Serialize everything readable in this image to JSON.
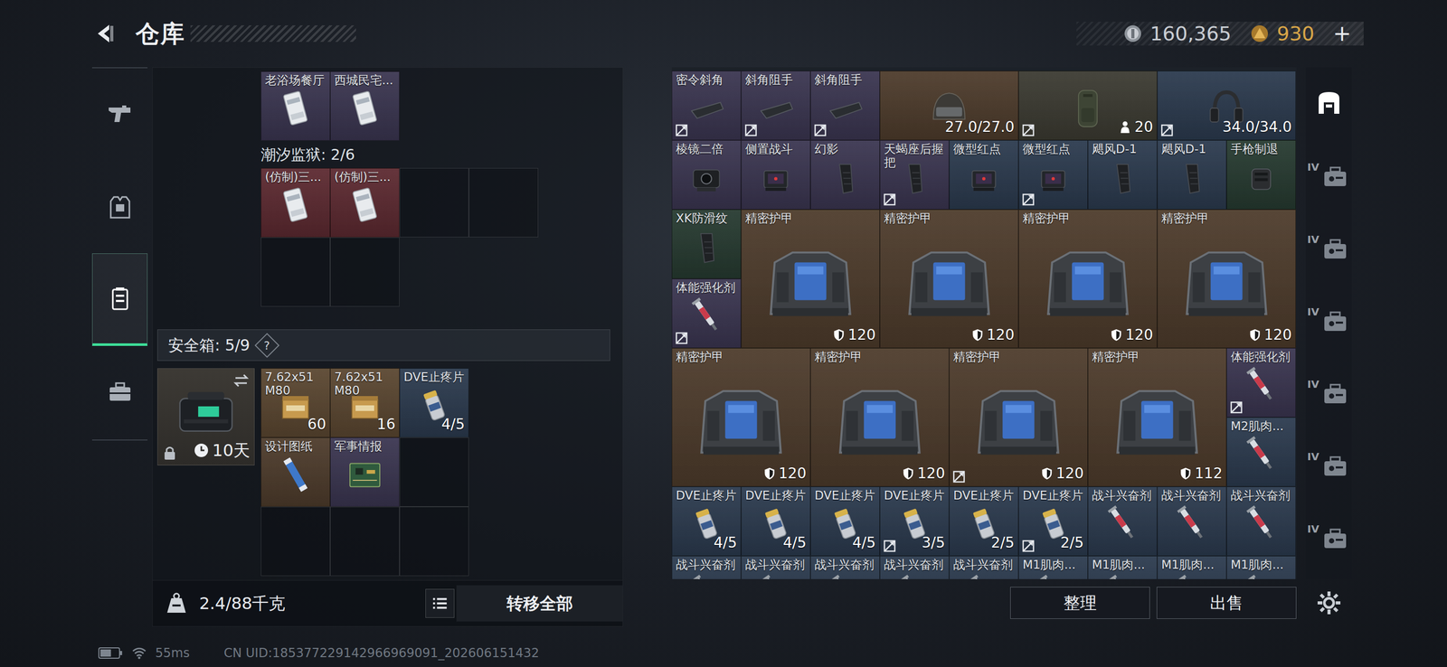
{
  "header": {
    "title": "仓库"
  },
  "wallet": {
    "currencies": [
      {
        "amount": "160,365",
        "color": "#c9cdd3"
      },
      {
        "amount": "930",
        "color": "#d8a548"
      }
    ],
    "topup": "+"
  },
  "sidebar": {
    "items": [
      {
        "kind": "weapon",
        "selected": false
      },
      {
        "kind": "gear",
        "selected": false
      },
      {
        "kind": "container",
        "selected": true
      },
      {
        "kind": "case",
        "selected": false
      }
    ]
  },
  "stash": {
    "sections": [
      {
        "slots": [
          {
            "kind": "key",
            "label": "老浴场餐厅",
            "color": "#3a3550"
          },
          {
            "kind": "key",
            "label": "西城民宅...",
            "color": "#3a3550"
          }
        ]
      },
      {
        "title": "潮汐监狱: 2/6",
        "slots": [
          {
            "kind": "key",
            "label": "(仿制)三...",
            "color": "#5c2930"
          },
          {
            "kind": "key",
            "label": "(仿制)三...",
            "color": "#5c2930"
          },
          {
            "kind": "empty"
          },
          {
            "kind": "empty"
          },
          {
            "kind": "empty"
          },
          {
            "kind": "empty"
          }
        ]
      }
    ],
    "safe_box": {
      "title": "安全箱: 5/9",
      "help": "?",
      "timer": "10天",
      "locked": true,
      "slots": [
        {
          "kind": "ammo",
          "label": "7.62x51 M80",
          "value": "60",
          "color": "#5a4630"
        },
        {
          "kind": "ammo",
          "label": "7.62x51 M80",
          "value": "16",
          "color": "#5a4630"
        },
        {
          "kind": "medicine",
          "label": "DVE止疼片",
          "value": "4/5",
          "color": "#2b3a4e"
        },
        {
          "kind": "blueprint",
          "label": "设计图纸",
          "color": "#4d3b2b"
        },
        {
          "kind": "intel",
          "label": "军事情报",
          "color": "#3a3550"
        },
        {
          "kind": "empty"
        },
        {
          "kind": "empty"
        },
        {
          "kind": "empty"
        },
        {
          "kind": "empty"
        }
      ]
    },
    "weight": "2.4/88千克",
    "transfer_button": "转移全部"
  },
  "inventory": {
    "items": [
      {
        "kind": "attachment",
        "label": "密令斜角",
        "color": "#3a3550",
        "bound": true
      },
      {
        "kind": "attachment",
        "label": "斜角阻手",
        "color": "#3a3550",
        "bound": true
      },
      {
        "kind": "attachment",
        "label": "斜角阻手",
        "color": "#3a3550",
        "bound": true
      },
      {
        "kind": "helmet",
        "value": "27.0/27.0",
        "color": "#4d3b2b",
        "bound": false
      },
      {
        "kind": "backpack",
        "value": "20",
        "color": "#3b3a31",
        "bound": true
      },
      {
        "kind": "headset",
        "value": "34.0/34.0",
        "color": "#2b3a4e",
        "bound": true
      },
      {
        "kind": "scope",
        "label": "棱镜二倍",
        "color": "#3a3550",
        "bound": false
      },
      {
        "kind": "sight",
        "label": "侧置战斗",
        "color": "#3a3550",
        "bound": false
      },
      {
        "kind": "grip",
        "label": "幻影",
        "color": "#3a3550",
        "bound": false
      },
      {
        "kind": "grip",
        "label": "天蝎座后握把",
        "color": "#3a3550",
        "bound": true
      },
      {
        "kind": "sight",
        "label": "微型红点",
        "color": "#2b3a4e",
        "bound": false
      },
      {
        "kind": "sight",
        "label": "微型红点",
        "color": "#2b3a4e",
        "bound": true
      },
      {
        "kind": "grip",
        "label": "飓风D-1",
        "color": "#2b3a4e",
        "bound": false
      },
      {
        "kind": "grip",
        "label": "飓风D-1",
        "color": "#2b3a4e",
        "bound": false
      },
      {
        "kind": "muzzle",
        "label": "手枪制退",
        "color": "#263a30",
        "bound": false
      },
      {
        "kind": "grip",
        "label": "XK防滑纹",
        "color": "#263a30",
        "bound": false
      },
      {
        "kind": "armor",
        "label": "精密护甲",
        "value": "120",
        "color": "#4d3b2b",
        "bound": false
      },
      {
        "kind": "armor",
        "label": "精密护甲",
        "value": "120",
        "color": "#4d3b2b",
        "bound": false
      },
      {
        "kind": "armor",
        "label": "精密护甲",
        "value": "120",
        "color": "#4d3b2b",
        "bound": false
      },
      {
        "kind": "armor",
        "label": "精密护甲",
        "value": "120",
        "color": "#4d3b2b",
        "bound": false
      },
      {
        "kind": "stim",
        "label": "体能强化剂",
        "color": "#3a3550",
        "bound": true
      },
      {
        "kind": "armor",
        "label": "精密护甲",
        "value": "120",
        "color": "#4d3b2b",
        "bound": false
      },
      {
        "kind": "armor",
        "label": "精密护甲",
        "value": "120",
        "color": "#4d3b2b",
        "bound": false
      },
      {
        "kind": "armor",
        "label": "精密护甲",
        "value": "120",
        "color": "#4d3b2b",
        "bound": true
      },
      {
        "kind": "armor",
        "label": "精密护甲",
        "value": "112",
        "color": "#4d3b2b",
        "bound": false
      },
      {
        "kind": "stim",
        "label": "体能强化剂",
        "color": "#3a3550",
        "bound": true
      },
      {
        "kind": "stim",
        "label": "M2肌肉...",
        "color": "#2b3a4e",
        "bound": false
      },
      {
        "kind": "medicine",
        "label": "DVE止疼片",
        "value": "4/5",
        "color": "#2b3a4e",
        "bound": false
      },
      {
        "kind": "medicine",
        "label": "DVE止疼片",
        "value": "4/5",
        "color": "#2b3a4e",
        "bound": false
      },
      {
        "kind": "medicine",
        "label": "DVE止疼片",
        "value": "4/5",
        "color": "#2b3a4e",
        "bound": false
      },
      {
        "kind": "medicine",
        "label": "DVE止疼片",
        "value": "3/5",
        "color": "#2b3a4e",
        "bound": true
      },
      {
        "kind": "medicine",
        "label": "DVE止疼片",
        "value": "2/5",
        "color": "#2b3a4e",
        "bound": false
      },
      {
        "kind": "medicine",
        "label": "DVE止疼片",
        "value": "2/5",
        "color": "#2b3a4e",
        "bound": true
      },
      {
        "kind": "stim",
        "label": "战斗兴奋剂",
        "color": "#2b3a4e",
        "bound": false
      },
      {
        "kind": "stim",
        "label": "战斗兴奋剂",
        "color": "#2b3a4e",
        "bound": false
      },
      {
        "kind": "stim",
        "label": "战斗兴奋剂",
        "color": "#2b3a4e",
        "bound": false
      },
      {
        "kind": "stim",
        "label": "战斗兴奋剂",
        "color": "#2b3a4e",
        "bound": false
      },
      {
        "kind": "stim",
        "label": "战斗兴奋剂",
        "color": "#2b3a4e",
        "bound": false
      },
      {
        "kind": "stim",
        "label": "战斗兴奋剂",
        "color": "#2b3a4e",
        "bound": false
      },
      {
        "kind": "stim",
        "label": "战斗兴奋剂",
        "color": "#2b3a4e",
        "bound": false
      },
      {
        "kind": "stim",
        "label": "战斗兴奋剂",
        "color": "#2b3a4e",
        "bound": false
      },
      {
        "kind": "stim",
        "label": "M1肌肉...",
        "color": "#2b3a4e",
        "bound": false
      },
      {
        "kind": "stim",
        "label": "M1肌肉...",
        "color": "#2b3a4e",
        "bound": false
      },
      {
        "kind": "stim",
        "label": "M1肌肉...",
        "color": "#2b3a4e",
        "bound": false
      },
      {
        "kind": "stim",
        "label": "M1肌肉...",
        "color": "#2b3a4e",
        "bound": false
      }
    ]
  },
  "categories": [
    {
      "kind": "storage",
      "selected": true
    },
    {
      "kind": "case",
      "label": "IV",
      "selected": false
    },
    {
      "kind": "case",
      "label": "IV",
      "selected": false
    },
    {
      "kind": "case",
      "label": "IV",
      "selected": false
    },
    {
      "kind": "case",
      "label": "IV",
      "selected": false
    },
    {
      "kind": "case",
      "label": "IV",
      "selected": false
    },
    {
      "kind": "case",
      "label": "IV",
      "selected": false
    }
  ],
  "actions": [
    "整理",
    "出售"
  ],
  "status_bar": {
    "battery_level": 0.6,
    "ping": "55ms",
    "uid": "CN UID:185377229142966969091_202606151432"
  }
}
